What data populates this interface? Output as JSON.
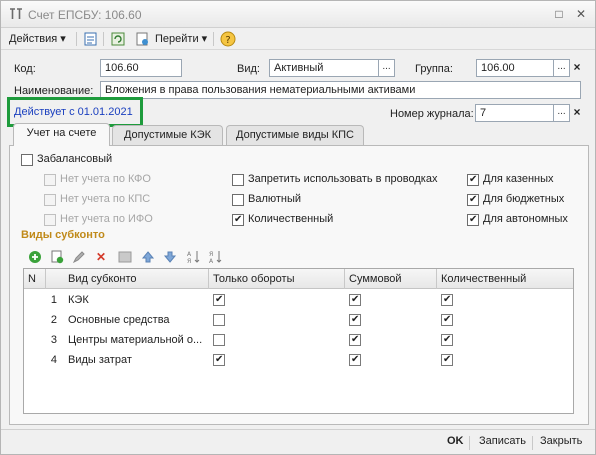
{
  "window": {
    "title": "Счет ЕПСБУ: 106.60",
    "app_icon": "1C",
    "controls": [
      "□",
      "✕"
    ]
  },
  "toolbar": {
    "actions_label": "Действия",
    "goto_label": "Перейти",
    "help_label": "?"
  },
  "form": {
    "code_label": "Код:",
    "code_value": "106.60",
    "kind_label": "Вид:",
    "kind_value": "Активный",
    "group_label": "Группа:",
    "group_value": "106.00",
    "name_label": "Наименование:",
    "name_value": "Вложения в права пользования нематериальными активами",
    "effective_text": "Действует с 01.01.2021",
    "journal_label": "Номер журнала:",
    "journal_value": "7",
    "select_btn": "...",
    "clear_btn": "×"
  },
  "tabs": [
    {
      "label": "Учет на счете",
      "active": true
    },
    {
      "label": "Допустимые КЭК",
      "active": false
    },
    {
      "label": "Допустимые виды КПС",
      "active": false
    }
  ],
  "options": {
    "off_balance": {
      "label": "Забалансовый",
      "checked": false
    },
    "no_kfo": {
      "label": "Нет учета по КФО",
      "checked": false
    },
    "no_kps": {
      "label": "Нет учета по КПС",
      "checked": false
    },
    "no_ifo": {
      "label": "Нет учета по ИФО",
      "checked": false
    },
    "forbid_entries": {
      "label": "Запретить использовать в проводках",
      "checked": false
    },
    "currency": {
      "label": "Валютный",
      "checked": false
    },
    "quantity": {
      "label": "Количественный",
      "checked": true
    },
    "for_state": {
      "label": "Для казенных",
      "checked": true
    },
    "for_budget": {
      "label": "Для бюджетных",
      "checked": true
    },
    "for_autonomous": {
      "label": "Для автономных",
      "checked": true
    }
  },
  "subconto": {
    "title": "Виды субконто",
    "columns": [
      "N",
      "Вид субконто",
      "Только обороты",
      "Суммовой",
      "Количественный"
    ],
    "rows": [
      {
        "n": "1",
        "name": "КЭК",
        "turnover_only": true,
        "sum": true,
        "quantity": true
      },
      {
        "n": "2",
        "name": "Основные средства",
        "turnover_only": false,
        "sum": true,
        "quantity": true
      },
      {
        "n": "3",
        "name": "Центры материальной о...",
        "turnover_only": false,
        "sum": true,
        "quantity": true
      },
      {
        "n": "4",
        "name": "Виды затрат",
        "turnover_only": true,
        "sum": true,
        "quantity": true
      }
    ]
  },
  "bottom": {
    "ok_label": "OK",
    "save_label": "Записать",
    "close_label": "Закрыть"
  }
}
